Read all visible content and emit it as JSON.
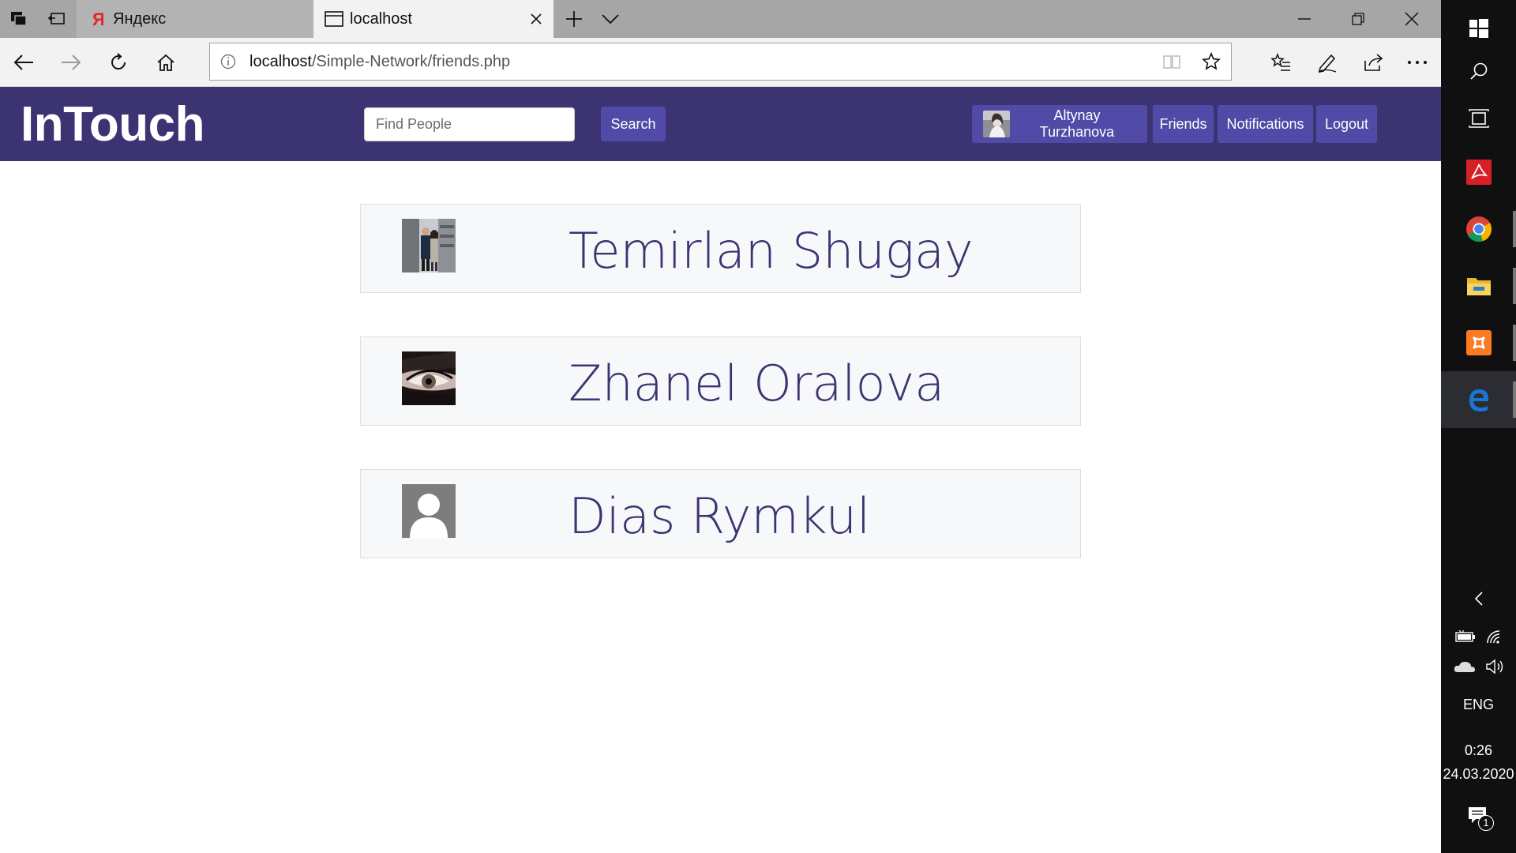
{
  "browser": {
    "tabs": [
      {
        "label": "Яндекс",
        "icon": "yandex-logo-icon",
        "active": false
      },
      {
        "label": "localhost",
        "icon": "page-icon",
        "active": true
      }
    ],
    "address": {
      "host": "localhost",
      "path": "/Simple-Network/friends.php"
    }
  },
  "site": {
    "brand": "InTouch",
    "search": {
      "placeholder": "Find People",
      "button_label": "Search"
    },
    "nav": {
      "profile_name": "Altynay Turzhanova",
      "friends_label": "Friends",
      "notifications_label": "Notifications",
      "logout_label": "Logout"
    },
    "colors": {
      "header_bg": "#3c3472",
      "button_bg": "#514aa6",
      "name_text": "#3c3472"
    }
  },
  "friends": [
    {
      "name": "Temirlan Shugay",
      "photo": "photo"
    },
    {
      "name": "Zhanel Oralova",
      "photo": "photo"
    },
    {
      "name": "Dias Rymkul",
      "photo": "default-avatar"
    }
  ],
  "taskbar": {
    "apps": [
      "windows-start-icon",
      "search-icon",
      "task-view-icon",
      "acrobat-icon",
      "chrome-icon",
      "file-explorer-icon",
      "xampp-icon",
      "edge-icon"
    ],
    "language": "ENG",
    "time": "0:26",
    "date": "24.03.2020",
    "notification_count": "1"
  }
}
